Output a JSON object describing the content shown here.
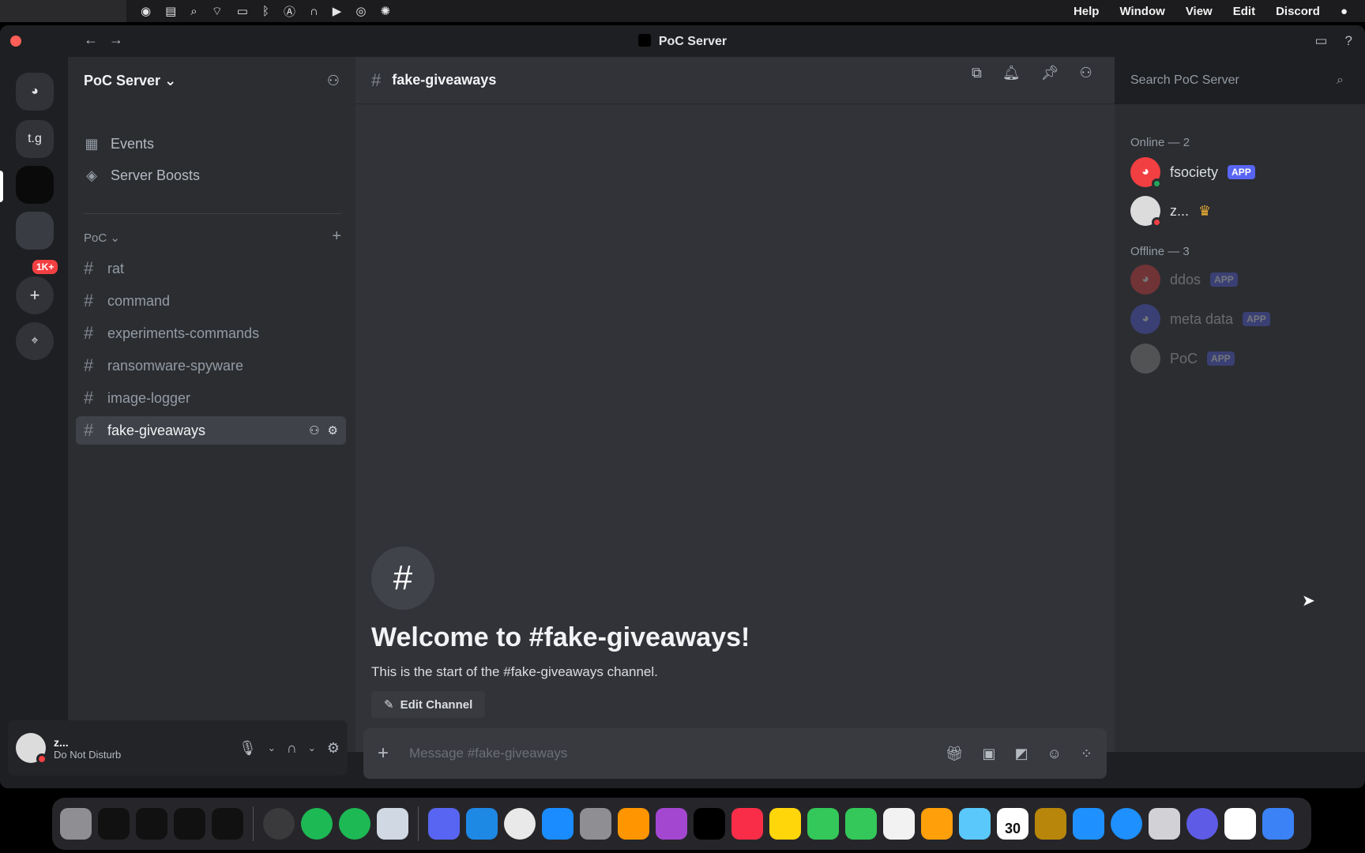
{
  "menubar": {
    "menus": [
      "Help",
      "Window",
      "View",
      "Edit",
      "Discord"
    ],
    "status_icons": [
      "siri-icon",
      "control-center-icon",
      "spotlight-icon",
      "wifi-icon",
      "battery-icon",
      "bluetooth-icon",
      "input-source-icon",
      "headphones-icon",
      "play-icon",
      "screen-record-icon",
      "extension-icon"
    ]
  },
  "window": {
    "title": "PoC Server"
  },
  "rail": {
    "servers": [
      {
        "label": "t.g"
      },
      {
        "label": ""
      },
      {
        "label": ""
      }
    ],
    "badge": "1K+"
  },
  "server": {
    "name": "PoC Server",
    "links": [
      {
        "label": "Events"
      },
      {
        "label": "Server Boosts"
      }
    ],
    "category": "PoC",
    "channels": [
      {
        "name": "rat"
      },
      {
        "name": "command"
      },
      {
        "name": "experiments-commands"
      },
      {
        "name": "ransomware-spyware"
      },
      {
        "name": "image-logger"
      },
      {
        "name": "fake-giveaways"
      }
    ]
  },
  "user": {
    "name": "z...",
    "status": "Do Not Disturb"
  },
  "chat": {
    "channel_name": "fake-giveaways",
    "welcome_title": "Welcome to #fake-giveaways!",
    "welcome_text": "This is the start of the #fake-giveaways channel.",
    "edit_button": "Edit Channel",
    "composer_placeholder": "Message #fake-giveaways"
  },
  "search": {
    "placeholder": "Search PoC Server"
  },
  "members": {
    "online_title": "Online — 2",
    "offline_title": "Offline — 3",
    "app_tag": "APP",
    "online": [
      {
        "name": "fsociety",
        "app": true
      },
      {
        "name": "z...",
        "app": false
      }
    ],
    "offline": [
      {
        "name": "ddos",
        "app": true
      },
      {
        "name": "meta data",
        "app": true
      },
      {
        "name": "PoC",
        "app": true
      }
    ]
  },
  "dock": {
    "calendar_day": "30"
  },
  "colors": {
    "accent": "#5865f2",
    "dnd": "#f23f43",
    "online": "#23a55a"
  }
}
